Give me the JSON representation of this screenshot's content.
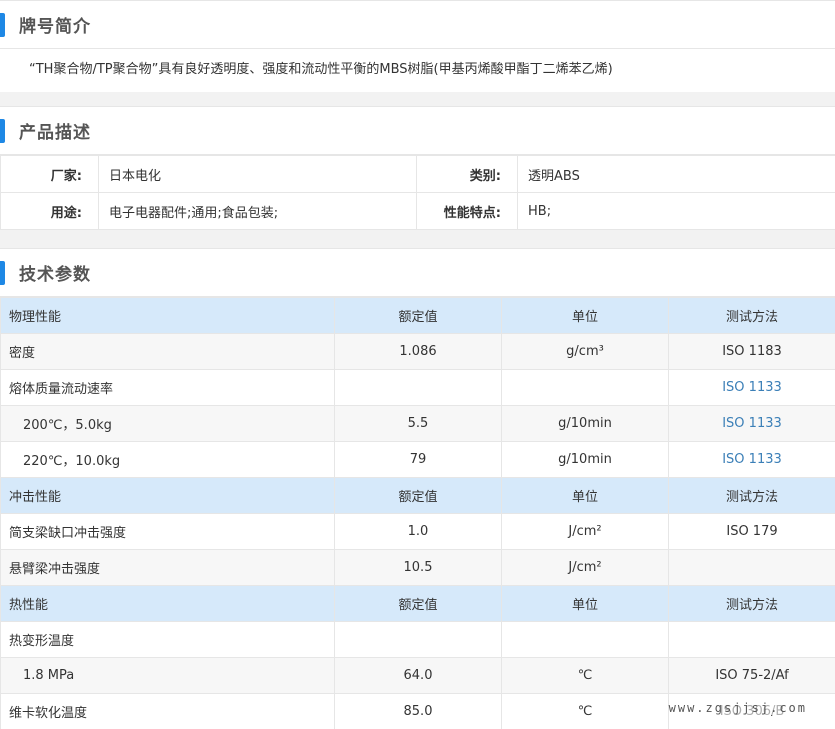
{
  "intro": {
    "title": "牌号简介",
    "text": "“TH聚合物/TP聚合物”具有良好透明度、强度和流动性平衡的MBS树脂(甲基丙烯酸甲酯丁二烯苯乙烯)"
  },
  "desc": {
    "title": "产品描述",
    "rows": [
      {
        "k1": "厂家:",
        "v1": "日本电化",
        "k2": "类别:",
        "v2": "透明ABS"
      },
      {
        "k1": "用途:",
        "v1": "电子电器配件;通用;食品包装;",
        "k2": "性能特点:",
        "v2": "HB;"
      }
    ]
  },
  "specs": {
    "title": "技术参数",
    "rows": [
      {
        "kind": "header",
        "name": "物理性能",
        "value": "额定值",
        "unit": "单位",
        "method": "测试方法"
      },
      {
        "kind": "alt",
        "name": "密度",
        "value": "1.086",
        "unit": "g/cm³",
        "method": "ISO 1183"
      },
      {
        "kind": "row",
        "name": "熔体质量流动速率",
        "value": "",
        "unit": "",
        "method": "ISO 1133",
        "link": true
      },
      {
        "kind": "alt",
        "name": "200℃，5.0kg",
        "sub": true,
        "value": "5.5",
        "unit": "g/10min",
        "method": "ISO 1133",
        "link": true
      },
      {
        "kind": "row",
        "name": "220℃，10.0kg",
        "sub": true,
        "value": "79",
        "unit": "g/10min",
        "method": "ISO 1133",
        "link": true
      },
      {
        "kind": "header",
        "name": "冲击性能",
        "value": "额定值",
        "unit": "单位",
        "method": "测试方法"
      },
      {
        "kind": "row",
        "name": "简支梁缺口冲击强度",
        "value": "1.0",
        "unit": "J/cm²",
        "method": "ISO 179"
      },
      {
        "kind": "alt",
        "name": "悬臂梁冲击强度",
        "value": "10.5",
        "unit": "J/cm²",
        "method": ""
      },
      {
        "kind": "header",
        "name": "热性能",
        "value": "额定值",
        "unit": "单位",
        "method": "测试方法"
      },
      {
        "kind": "row",
        "name": "热变形温度",
        "value": "",
        "unit": "",
        "method": ""
      },
      {
        "kind": "alt",
        "name": "1.8 MPa",
        "sub": true,
        "value": "64.0",
        "unit": "℃",
        "method": "ISO 75-2/Af"
      },
      {
        "kind": "row",
        "name": "维卡软化温度",
        "value": "85.0",
        "unit": "℃",
        "method": "ISO 306/B"
      }
    ]
  },
  "watermark": "www.zgsjjsj.com"
}
